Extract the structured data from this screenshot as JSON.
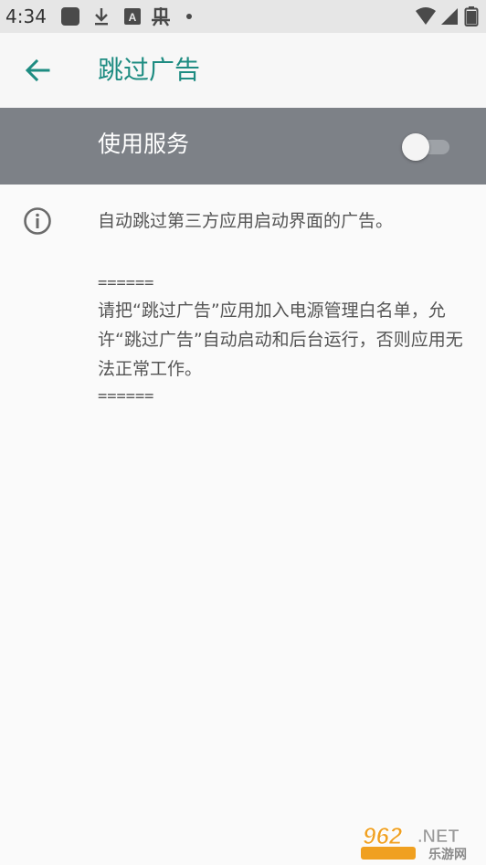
{
  "status_bar": {
    "time": "4:34",
    "icons": [
      "app-square-icon",
      "download-icon",
      "a-box-icon",
      "bug-icon",
      "dot-icon",
      "wifi-icon",
      "signal-icon",
      "battery-icon"
    ],
    "a_box_letter": "A"
  },
  "app_bar": {
    "title": "跳过广告",
    "back_icon": "arrow-back-icon"
  },
  "service": {
    "label": "使用服务",
    "enabled": false
  },
  "info": {
    "icon": "info-icon",
    "description": "自动跳过第三方应用启动界面的广告。",
    "separator_top": "======",
    "notice": "请把“跳过广告”应用加入电源管理白名单，允许“跳过广告”自动启动和后台运行，否则应用无法正常工作。",
    "separator_bottom": "======"
  },
  "watermark": {
    "number": "962",
    "suffix": ".NET",
    "caption": "乐游网"
  },
  "colors": {
    "accent": "#1e8c82",
    "service_bar": "#7d8187",
    "text": "#555555",
    "background": "#fafafa"
  }
}
